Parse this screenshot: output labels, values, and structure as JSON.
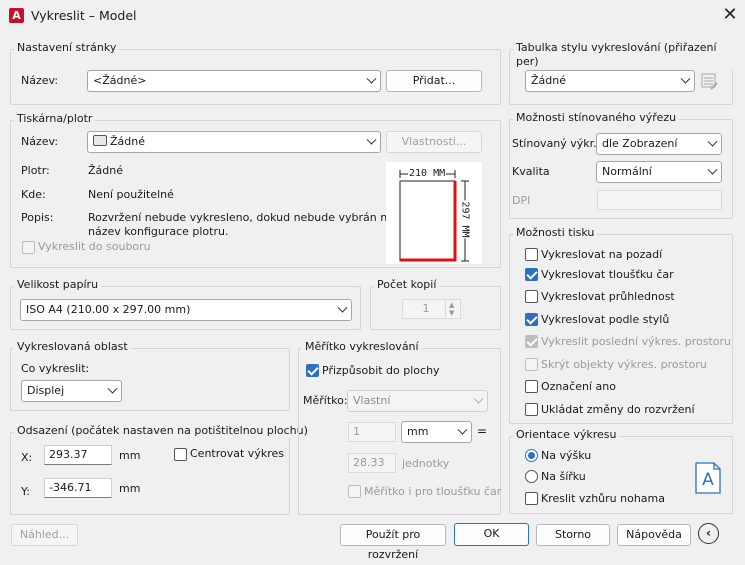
{
  "window": {
    "title": "Vykreslit – Model",
    "app_icon_letter": "A"
  },
  "page_setup": {
    "group": "Nastavení stránky",
    "name_label": "Název:",
    "name_value": "<Žádné>",
    "add_button": "Přidat..."
  },
  "printer": {
    "group": "Tiskárna/plotr",
    "name_label": "Název:",
    "name_value": "Žádné",
    "properties_button": "Vlastnosti...",
    "plotter_label": "Plotr:",
    "plotter_value": "Žádné",
    "where_label": "Kde:",
    "where_value": "Není použitelné",
    "desc_label": "Popis:",
    "desc_line1": "Rozvržení nebude vykresleno, dokud nebude vybrán nový",
    "desc_line2": "název konfigurace plotru.",
    "plot_to_file": "Vykreslit do souboru",
    "preview": {
      "width_label": "210 MM",
      "height_label": "297 MM"
    }
  },
  "paper_size": {
    "group": "Velikost papíru",
    "value": "ISO A4 (210.00 x 297.00 mm)"
  },
  "copies": {
    "group": "Počet kopií",
    "value": "1"
  },
  "plot_area": {
    "group": "Vykreslovaná oblast",
    "what_label": "Co vykreslit:",
    "what_value": "Displej"
  },
  "plot_offset": {
    "group": "Odsazení (počátek nastaven na potištitelnou plochu)",
    "x_label": "X:",
    "x_value": "293.37",
    "x_unit": "mm",
    "y_label": "Y:",
    "y_value": "-346.71",
    "y_unit": "mm",
    "center": "Centrovat výkres"
  },
  "plot_scale": {
    "group": "Měřítko vykreslování",
    "fit": "Přizpůsobit do plochy",
    "scale_label": "Měřítko:",
    "scale_value": "Vlastní",
    "num_value": "1",
    "unit_value": "mm",
    "equals": "=",
    "units_value": "28.33",
    "units_label": "jednotky",
    "lineweights": "Měřítko i pro tloušťku čar"
  },
  "style_table": {
    "group": "Tabulka stylu vykreslování (přiřazení per)",
    "value": "Žádné"
  },
  "shaded": {
    "group": "Možnosti stínovaného výřezu",
    "shade_label": "Stínovaný výkr.",
    "shade_value": "dle Zobrazení",
    "quality_label": "Kvalita",
    "quality_value": "Normální",
    "dpi_label": "DPI"
  },
  "options": {
    "group": "Možnosti tisku",
    "items": [
      {
        "label": "Vykreslovat na pozadí",
        "checked": false,
        "disabled": false
      },
      {
        "label": "Vykreslovat tloušťku čar",
        "checked": true,
        "disabled": false
      },
      {
        "label": "Vykreslovat průhlednost",
        "checked": false,
        "disabled": false
      },
      {
        "label": "Vykreslovat podle stylů",
        "checked": true,
        "disabled": false
      },
      {
        "label": "Vykreslit poslední výkres. prostoru",
        "checked": true,
        "disabled": true
      },
      {
        "label": "Skrýt objekty výkres. prostoru",
        "checked": false,
        "disabled": true
      },
      {
        "label": "Označení ano",
        "checked": false,
        "disabled": false
      },
      {
        "label": "Ukládat změny do rozvržení",
        "checked": false,
        "disabled": false
      }
    ]
  },
  "orientation": {
    "group": "Orientace výkresu",
    "portrait": "Na výšku",
    "landscape": "Na šířku",
    "upside_down": "Kreslit vzhůru nohama",
    "icon_letter": "A"
  },
  "footer": {
    "preview": "Náhled...",
    "apply": "Použít pro rozvržení",
    "ok": "OK",
    "cancel": "Storno",
    "help": "Nápověda"
  }
}
